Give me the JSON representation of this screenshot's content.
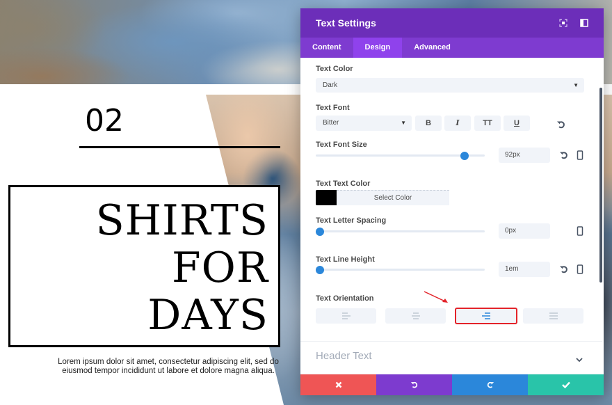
{
  "page": {
    "number": "02",
    "headline": "SHIRTS\nFOR\nDAYS",
    "body_text": "Lorem ipsum dolor sit amet, consectetur adipiscing elit, sed do eiusmod tempor incididunt ut labore et dolore magna aliqua."
  },
  "panel": {
    "title": "Text Settings",
    "header_icons": [
      "expand-icon",
      "split-view-icon"
    ],
    "tabs": [
      {
        "label": "Content",
        "active": false
      },
      {
        "label": "Design",
        "active": true
      },
      {
        "label": "Advanced",
        "active": false
      }
    ],
    "text_color": {
      "label": "Text Color",
      "value": "Dark"
    },
    "text_font": {
      "label": "Text Font",
      "value": "Bitter",
      "format_buttons": [
        "B",
        "I",
        "TT",
        "U"
      ]
    },
    "font_size": {
      "label": "Text Font Size",
      "value": "92px",
      "slider_percent": 90
    },
    "text_text_color": {
      "label": "Text Text Color",
      "swatch": "#000000",
      "button": "Select Color"
    },
    "letter_spacing": {
      "label": "Text Letter Spacing",
      "value": "0px",
      "slider_percent": 0
    },
    "line_height": {
      "label": "Text Line Height",
      "value": "1em",
      "slider_percent": 0
    },
    "orientation": {
      "label": "Text Orientation",
      "options": [
        "left",
        "center",
        "right",
        "justified"
      ],
      "selected": "right"
    },
    "collapsed_section": "Header Text",
    "footer": [
      "cancel",
      "undo",
      "redo",
      "save"
    ]
  },
  "colors": {
    "header": "#6c2eb9",
    "tabs": "#7e3bd0",
    "active_tab": "#8f42ec",
    "accent_blue": "#2b87da",
    "cancel": "#ef5555",
    "undo": "#7d3bcf",
    "redo": "#2b87da",
    "save": "#29c4a9",
    "highlight": "#e3232a"
  }
}
